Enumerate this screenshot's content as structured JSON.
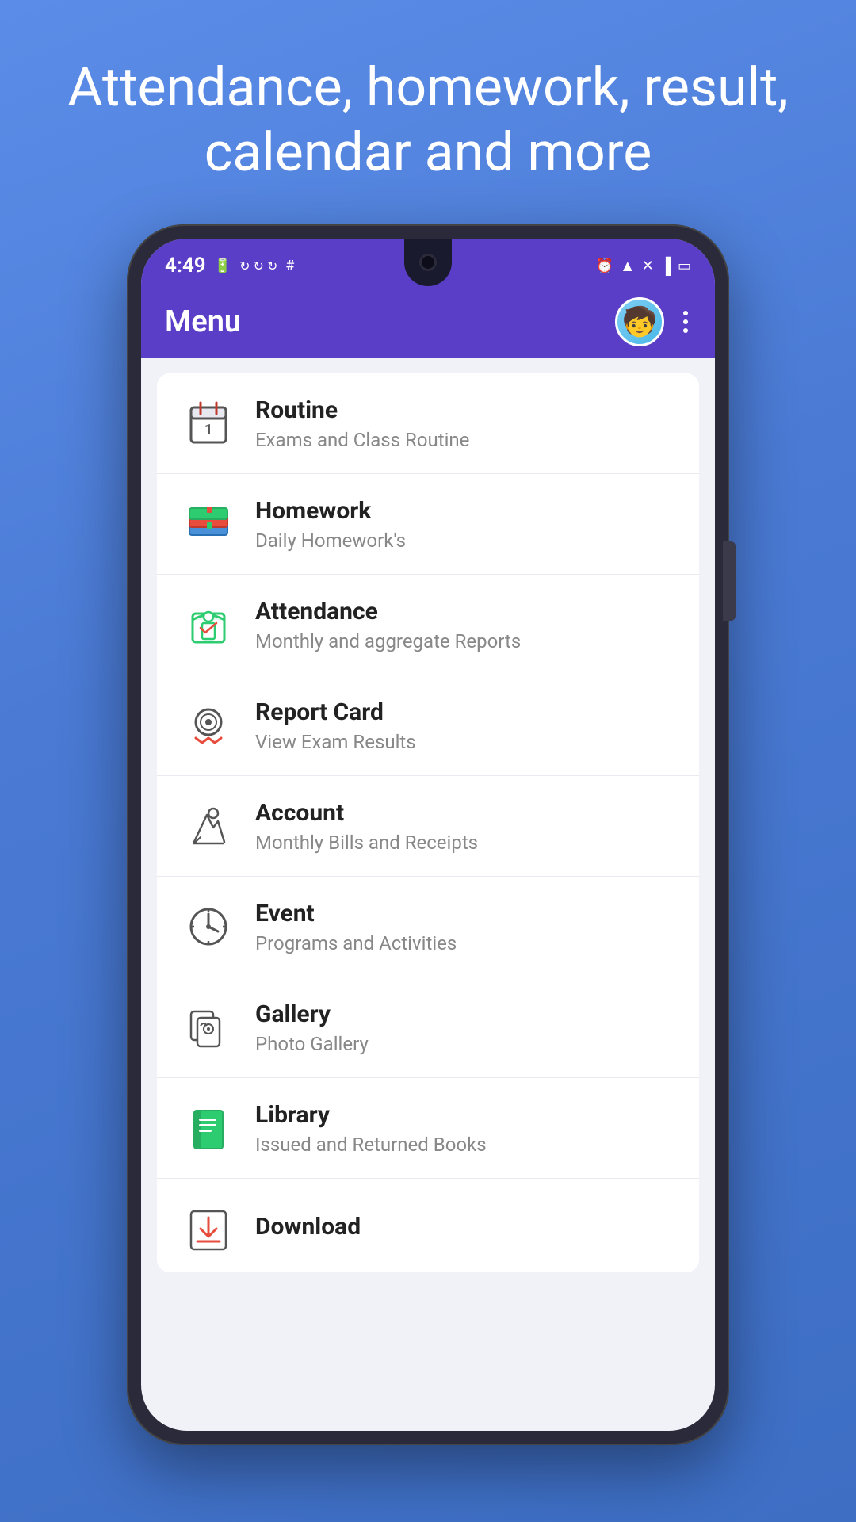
{
  "headline": "Attendance, homework, result, calendar and more",
  "status_bar": {
    "time": "4:49",
    "icons_left": [
      "battery-charging",
      "sync1",
      "sync2",
      "sync3",
      "slack"
    ],
    "icons_right": [
      "alarm",
      "wifi",
      "signal",
      "battery"
    ]
  },
  "header": {
    "title": "Menu",
    "avatar_emoji": "👦",
    "more_icon": "more-vertical"
  },
  "menu_items": [
    {
      "id": "routine",
      "title": "Routine",
      "subtitle": "Exams and Class Routine",
      "icon": "calendar"
    },
    {
      "id": "homework",
      "title": "Homework",
      "subtitle": "Daily Homework's",
      "icon": "books"
    },
    {
      "id": "attendance",
      "title": "Attendance",
      "subtitle": "Monthly and aggregate Reports",
      "icon": "briefcase"
    },
    {
      "id": "report-card",
      "title": "Report Card",
      "subtitle": "View Exam Results",
      "icon": "certificate"
    },
    {
      "id": "account",
      "title": "Account",
      "subtitle": "Monthly Bills and Receipts",
      "icon": "pen-tool"
    },
    {
      "id": "event",
      "title": "Event",
      "subtitle": "Programs and Activities",
      "icon": "clock"
    },
    {
      "id": "gallery",
      "title": "Gallery",
      "subtitle": "Photo Gallery",
      "icon": "image-files"
    },
    {
      "id": "library",
      "title": "Library",
      "subtitle": "Issued and Returned Books",
      "icon": "book"
    },
    {
      "id": "download",
      "title": "Download",
      "subtitle": "",
      "icon": "download"
    }
  ],
  "colors": {
    "header_bg": "#5b3ec8",
    "background": "#4a7ad4",
    "menu_bg": "#ffffff",
    "border": "#e8eaf0"
  }
}
